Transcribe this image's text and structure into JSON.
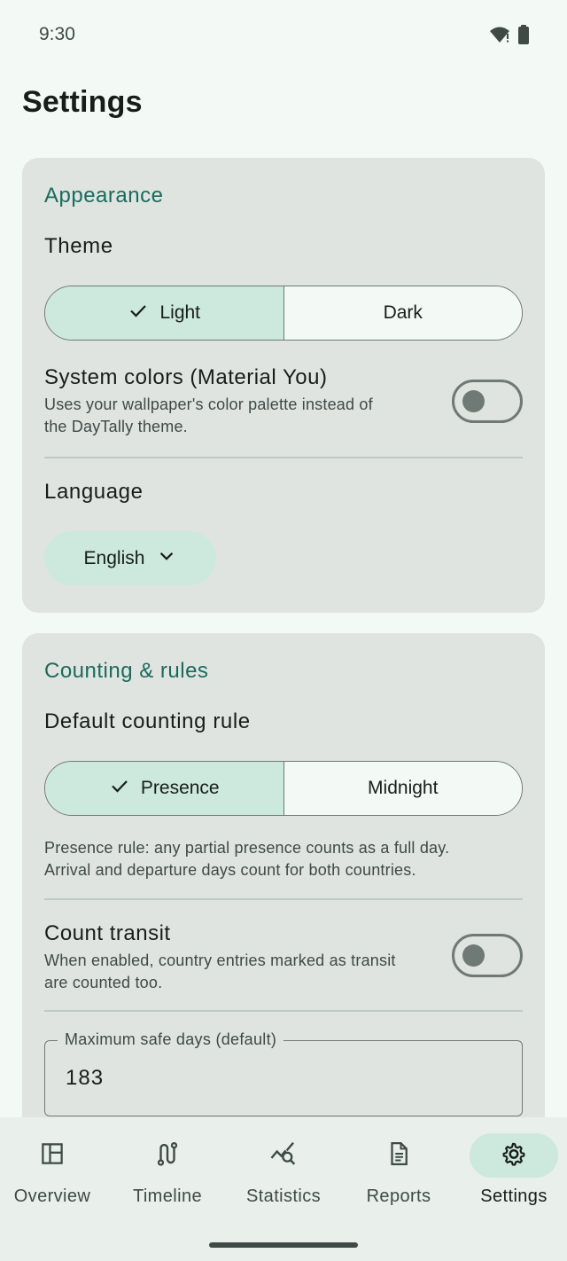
{
  "status_bar": {
    "time": "9:30",
    "icons": [
      "wifi-icon",
      "battery-icon"
    ]
  },
  "page_title": "Settings",
  "appearance": {
    "section_title": "Appearance",
    "theme_label": "Theme",
    "theme_options": {
      "light": "Light",
      "dark": "Dark"
    },
    "selected_theme": "Light",
    "system_colors": {
      "title": "System colors (Material You)",
      "subtitle_line1": "Uses your wallpaper's color palette instead of",
      "subtitle_line2": "the DayTally theme.",
      "enabled": false
    },
    "language_label": "Language",
    "language_value": "English"
  },
  "counting": {
    "section_title": "Counting & rules",
    "rule_label": "Default counting rule",
    "rule_options": {
      "presence": "Presence",
      "midnight": "Midnight"
    },
    "selected_rule": "Presence",
    "rule_desc_line1": "Presence rule: any partial presence counts as a full day.",
    "rule_desc_line2": "Arrival and departure days count for both countries.",
    "count_transit": {
      "title": "Count transit",
      "subtitle_line1": "When enabled, country entries marked as transit",
      "subtitle_line2": "are counted too.",
      "enabled": false
    },
    "max_days": {
      "label": "Maximum safe days (default)",
      "value": "183"
    }
  },
  "bottom_nav": {
    "items": [
      {
        "label": "Overview",
        "icon": "dashboard-icon",
        "active": false
      },
      {
        "label": "Timeline",
        "icon": "route-icon",
        "active": false
      },
      {
        "label": "Statistics",
        "icon": "query-stats-icon",
        "active": false
      },
      {
        "label": "Reports",
        "icon": "document-icon",
        "active": false
      },
      {
        "label": "Settings",
        "icon": "gear-icon",
        "active": true
      }
    ]
  },
  "colors": {
    "accent": "#1a6b5c",
    "selected_bg": "#cde8dd",
    "card_bg": "#dfe4e1",
    "page_bg": "#f3faf5"
  }
}
